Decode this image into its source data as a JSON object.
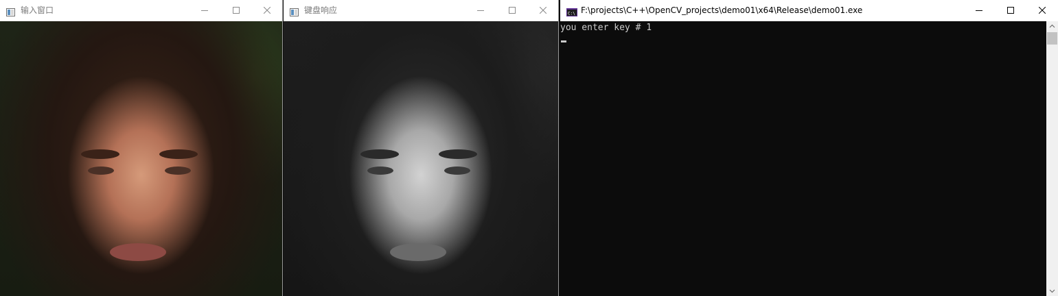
{
  "windows": {
    "input": {
      "title": "输入窗口",
      "icon": "opencv-window-icon"
    },
    "keyboard": {
      "title": "键盘响应",
      "icon": "opencv-window-icon"
    },
    "console": {
      "title": "F:\\projects\\C++\\OpenCV_projects\\demo01\\x64\\Release\\demo01.exe",
      "icon": "console-app-icon",
      "output_line": "you enter key # 1"
    }
  },
  "colors": {
    "titlebar": "#ffffff",
    "inactive_title_text": "#7a7a7a",
    "active_title_text": "#000000",
    "console_bg": "#0c0c0c",
    "console_text": "#cccccc"
  }
}
